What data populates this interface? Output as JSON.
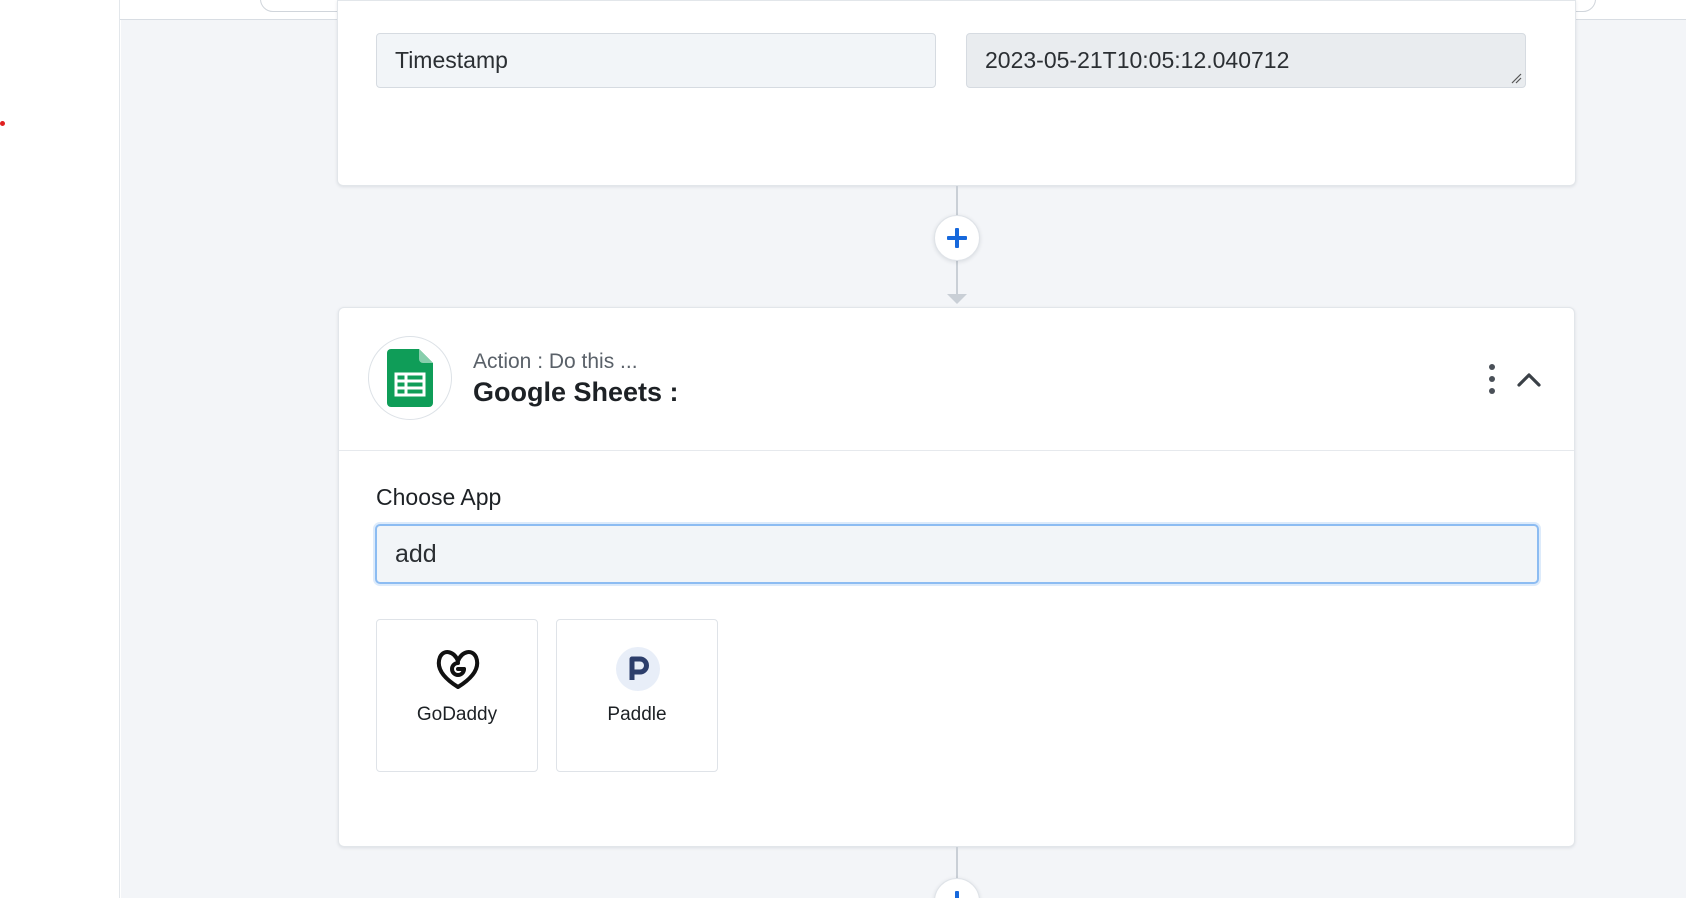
{
  "trigger_fields": {
    "key": "Timestamp",
    "value": "2023-05-21T10:05:12.040712"
  },
  "action_step": {
    "subtitle": "Action : Do this ...",
    "title": "Google Sheets :",
    "app_icon": "google-sheets-icon",
    "choose_app_label": "Choose App",
    "search_value": "add",
    "apps": [
      {
        "name": "GoDaddy",
        "icon": "godaddy-icon"
      },
      {
        "name": "Paddle",
        "icon": "paddle-icon"
      }
    ]
  },
  "colors": {
    "accent": "#1668dc",
    "sheets_green": "#0f9d58",
    "canvas_bg": "#f3f5f8",
    "paddle_blue": "#2c3e6b"
  }
}
